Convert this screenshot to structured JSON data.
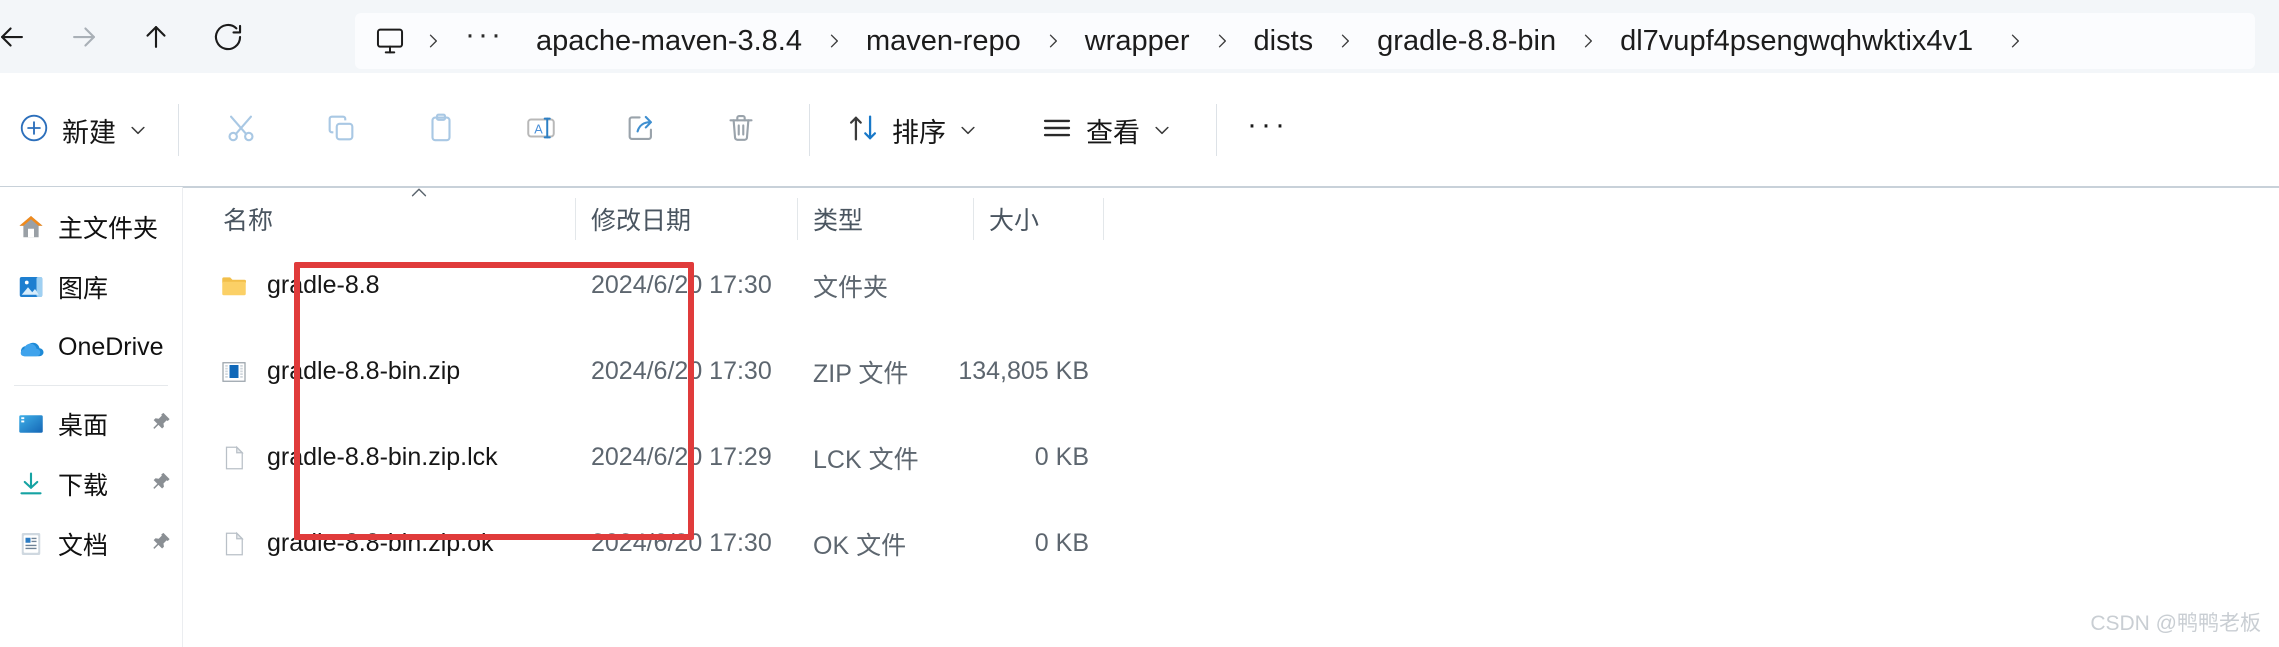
{
  "window": {
    "nav": {
      "back_label": "后退",
      "forward_label": "前进",
      "up_label": "向上",
      "refresh_label": "刷新"
    },
    "address": {
      "root_icon": "this-pc-icon",
      "overflow": "···",
      "crumbs": [
        "apache-maven-3.8.4",
        "maven-repo",
        "wrapper",
        "dists",
        "gradle-8.8-bin",
        "dl7vupf4psengwqhwktix4v1"
      ]
    }
  },
  "toolbar": {
    "new_label": "新建",
    "cut_label": "剪切",
    "copy_label": "复制",
    "paste_label": "粘贴",
    "rename_label": "重命名",
    "share_label": "共享",
    "delete_label": "删除",
    "sort_label": "排序",
    "view_label": "查看",
    "more_label": "···"
  },
  "sidebar": {
    "items": [
      {
        "label": "主文件夹",
        "icon": "home-icon",
        "pinned": false
      },
      {
        "label": "图库",
        "icon": "gallery-icon",
        "pinned": false
      },
      {
        "label": "OneDrive",
        "icon": "onedrive-cloud-icon",
        "pinned": false
      },
      {
        "label": "桌面",
        "icon": "desktop-icon",
        "pinned": true
      },
      {
        "label": "下载",
        "icon": "downloads-icon",
        "pinned": true
      },
      {
        "label": "文档",
        "icon": "documents-icon",
        "pinned": true
      }
    ]
  },
  "filelist": {
    "columns": {
      "name": "名称",
      "date": "修改日期",
      "type": "类型",
      "size": "大小"
    },
    "sort": {
      "column": "名称",
      "direction": "ascending",
      "glyph": "ⱏ"
    },
    "rows": [
      {
        "name": "gradle-8.8",
        "date": "2024/6/20 17:30",
        "type": "文件夹",
        "size": "",
        "icon": "folder-icon"
      },
      {
        "name": "gradle-8.8-bin.zip",
        "date": "2024/6/20 17:30",
        "type": "ZIP 文件",
        "size": "134,805 KB",
        "icon": "zip-file-icon"
      },
      {
        "name": "gradle-8.8-bin.zip.lck",
        "date": "2024/6/20 17:29",
        "type": "LCK 文件",
        "size": "0 KB",
        "icon": "generic-file-icon"
      },
      {
        "name": "gradle-8.8-bin.zip.ok",
        "date": "2024/6/20 17:30",
        "type": "OK 文件",
        "size": "0 KB",
        "icon": "generic-file-icon"
      }
    ]
  },
  "annotation": {
    "highlight_color": "#e03b3b"
  },
  "watermark": {
    "text": "CSDN @鸭鸭老板"
  }
}
